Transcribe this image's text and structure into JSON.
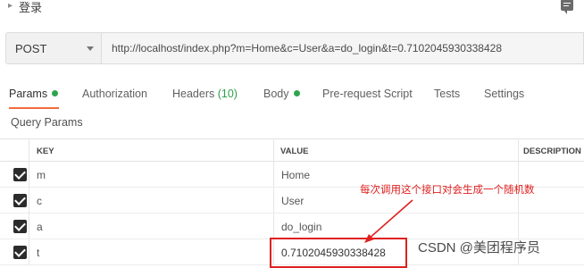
{
  "header": {
    "title": "登录"
  },
  "request": {
    "method": "POST",
    "url": "http://localhost/index.php?m=Home&c=User&a=do_login&t=0.7102045930338428"
  },
  "tabs": {
    "params": "Params",
    "authorization": "Authorization",
    "headers": "Headers",
    "headers_count": "(10)",
    "body": "Body",
    "prerequest": "Pre-request Script",
    "tests": "Tests",
    "settings": "Settings",
    "active": "Params",
    "indicator_color": "#2ea44f"
  },
  "query_params": {
    "title": "Query Params",
    "columns": [
      "KEY",
      "VALUE",
      "DESCRIPTION"
    ],
    "rows": [
      {
        "key": "m",
        "value": "Home",
        "checked": true
      },
      {
        "key": "c",
        "value": "User",
        "checked": true
      },
      {
        "key": "a",
        "value": "do_login",
        "checked": true
      },
      {
        "key": "t",
        "value": "0.7102045930338428",
        "checked": true
      }
    ]
  },
  "annotation": {
    "text": "每次调用这个接口对会生成一个随机数",
    "color": "#e02020"
  },
  "watermark": "CSDN @美团程序员"
}
